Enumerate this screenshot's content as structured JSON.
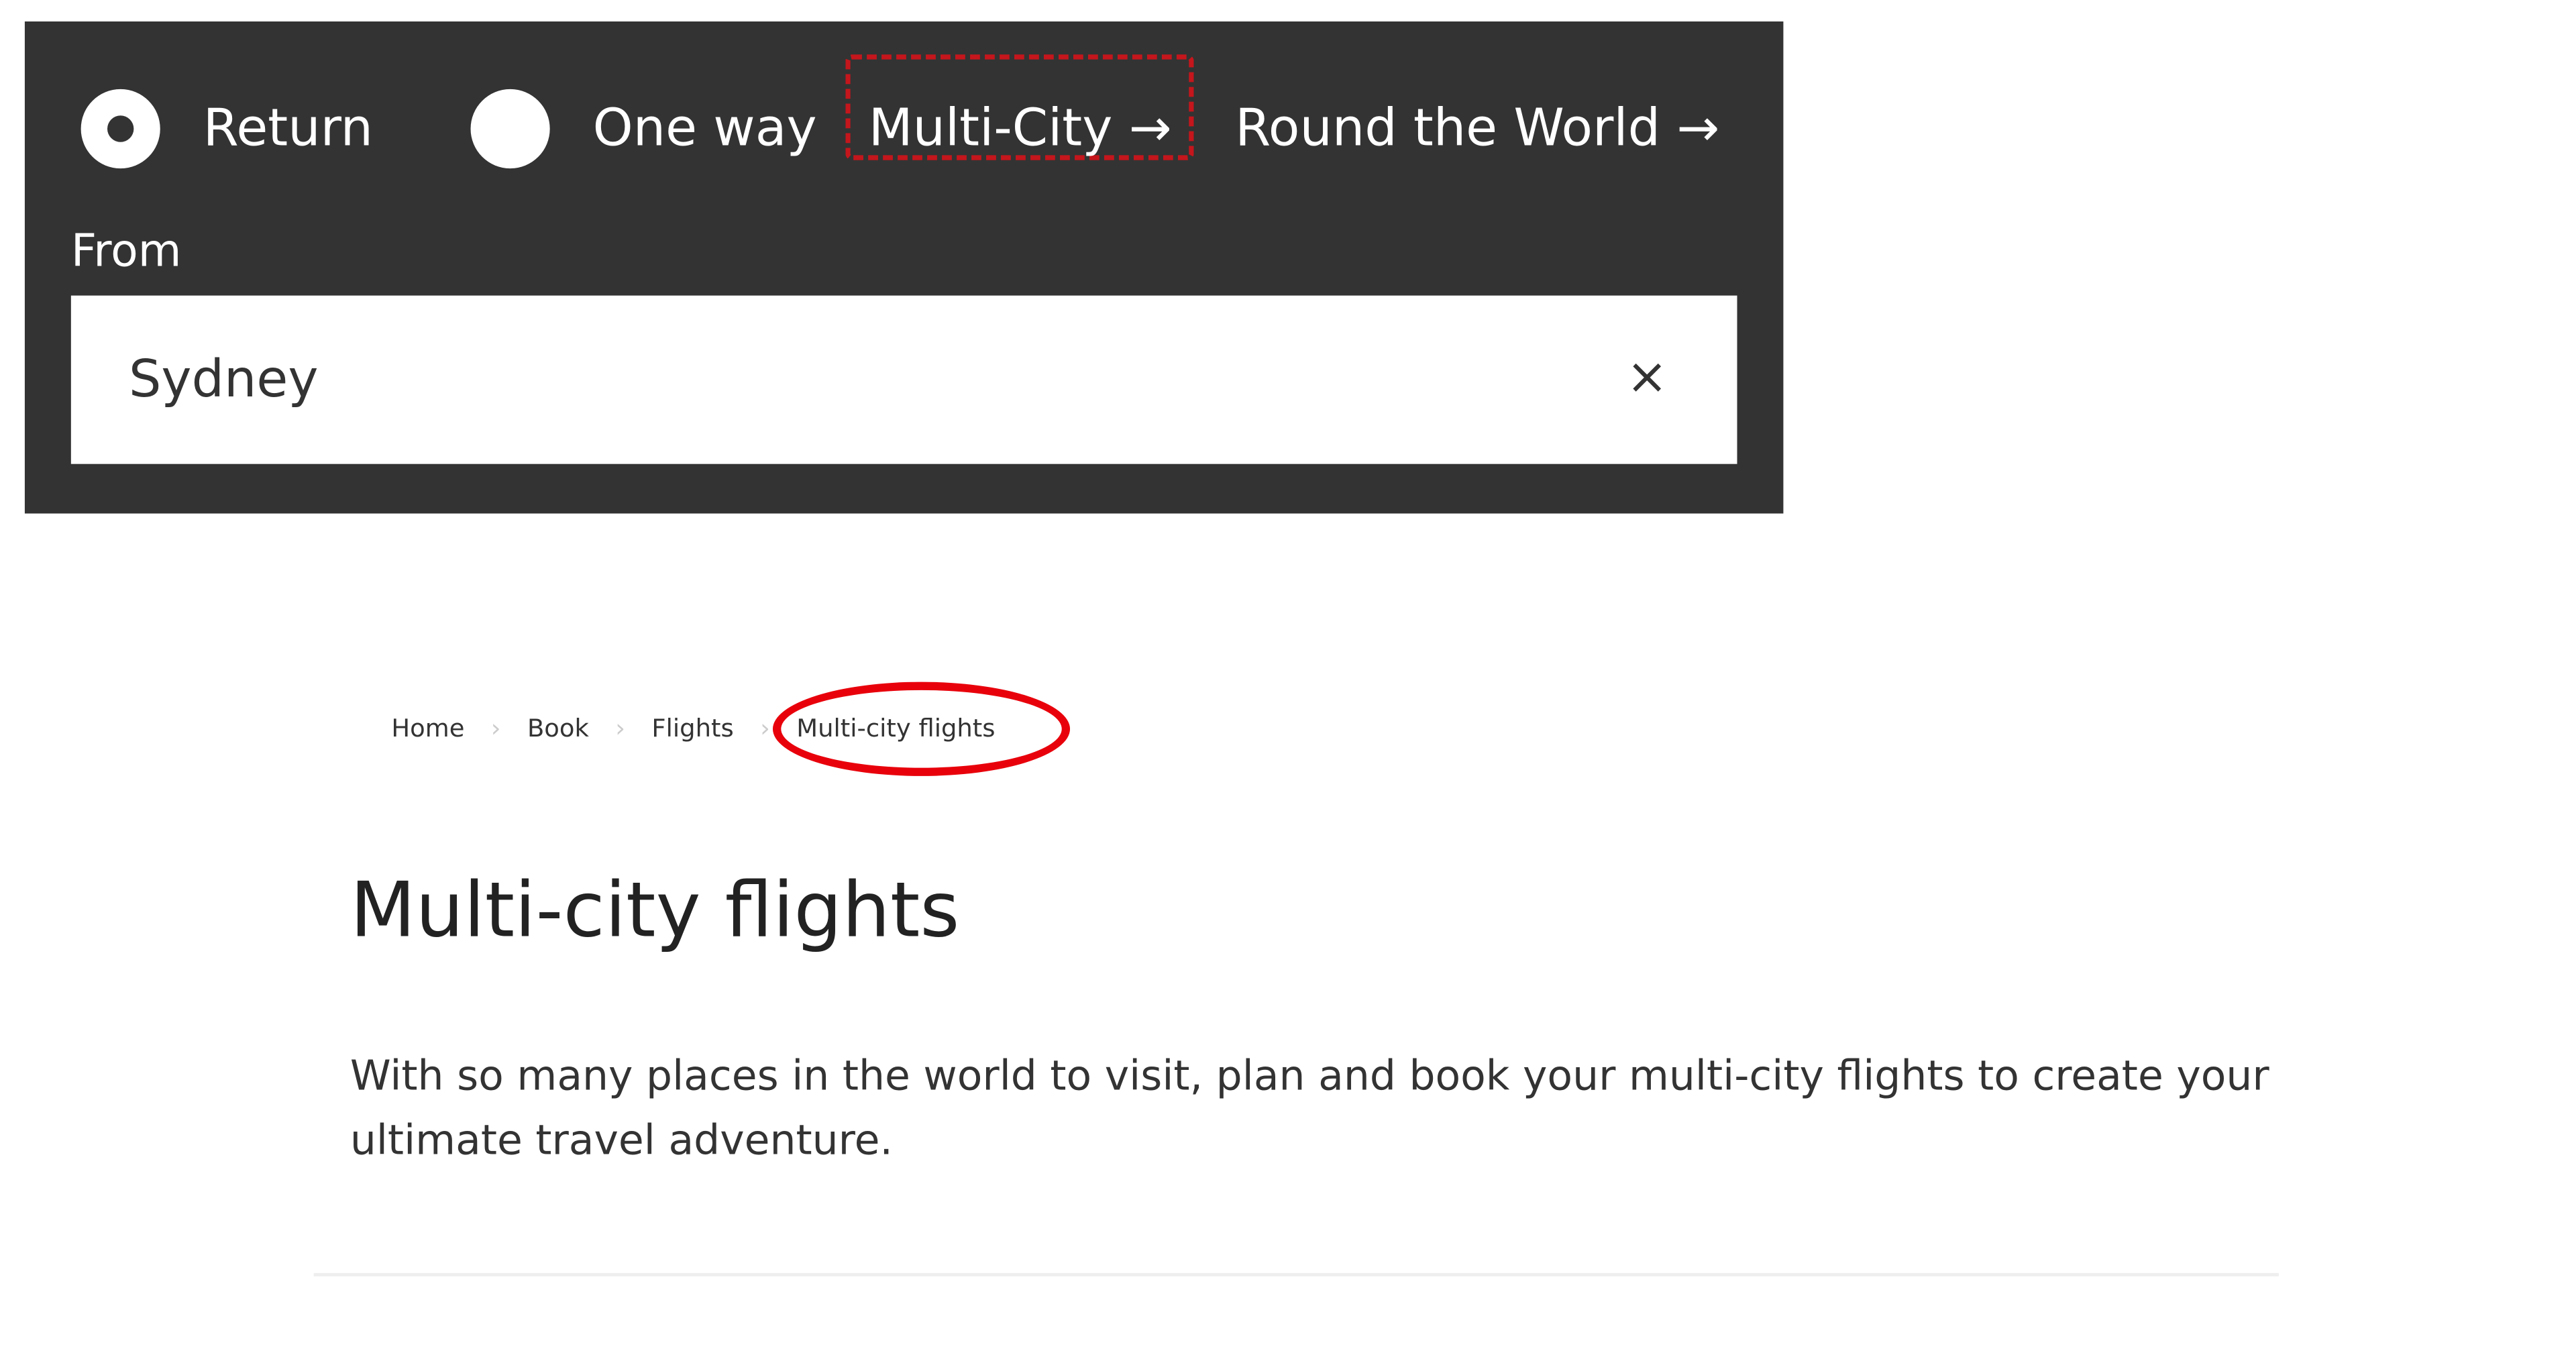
{
  "trip_types": {
    "return_label": "Return",
    "one_way_label": "One way",
    "multi_city_label": "Multi-City →",
    "round_world_label": "Round the World →",
    "selected": "Return"
  },
  "from": {
    "label": "From",
    "value": "Sydney",
    "clear_icon": "×"
  },
  "breadcrumb": {
    "items": [
      "Home",
      "Book",
      "Flights",
      "Multi-city flights"
    ],
    "separator": "›"
  },
  "page": {
    "title": "Multi-city flights",
    "description": "With so many places in the world to visit, plan and book your multi-city flights to create your ultimate travel adventure."
  },
  "colors": {
    "panel": "#333333",
    "annotation": "#e8000b"
  }
}
